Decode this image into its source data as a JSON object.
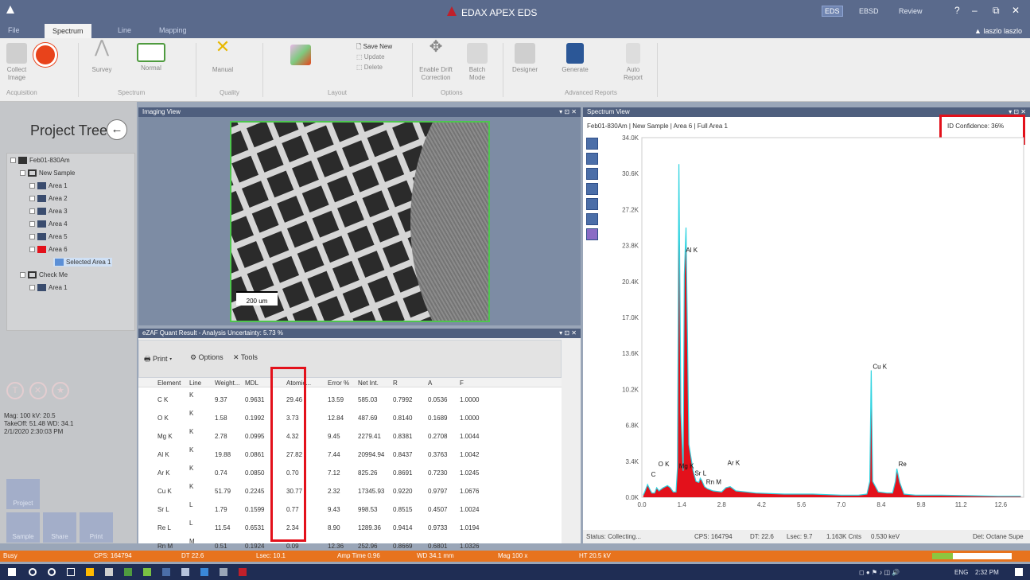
{
  "app": {
    "title": "EDAX APEX EDS",
    "modes": [
      "EDS",
      "EBSD",
      "Review"
    ],
    "active_mode": "EDS",
    "user": "laszlo laszlo"
  },
  "tabs": [
    "File",
    "Spectrum",
    "Line",
    "Mapping"
  ],
  "ribbon": {
    "buttons": [
      {
        "label": "Collect\nImage",
        "name": "collect-image"
      },
      {
        "label": "Survey",
        "name": "survey"
      },
      {
        "label": "Normal",
        "name": "normal"
      },
      {
        "label": "Manual",
        "name": "manual"
      },
      {
        "label": "Save New",
        "name": "save-new"
      },
      {
        "label": "Update",
        "name": "update"
      },
      {
        "label": "Delete",
        "name": "delete"
      },
      {
        "label": "Enable Drift\nCorrection",
        "name": "enable-drift-correction"
      },
      {
        "label": "Batch\nMode",
        "name": "batch-mode"
      },
      {
        "label": "Designer",
        "name": "designer"
      },
      {
        "label": "Generate",
        "name": "generate"
      },
      {
        "label": "Auto\nReport",
        "name": "auto-report"
      }
    ],
    "groups": [
      "Acquisition",
      "Spectrum",
      "Quality",
      "Layout",
      "Options",
      "Advanced Reports"
    ]
  },
  "project": {
    "title": "Project Tree",
    "nodes": [
      "Feb01-830Am",
      "New Sample",
      "Area 1",
      "Area 2",
      "Area 3",
      "Area 4",
      "Area 5",
      "Area 6",
      "Selected Area 1",
      "Check Me",
      "Area 1"
    ],
    "meta": [
      "Mag: 100 kV: 20.5",
      "TakeOff: 51.48 WD: 34.1",
      "2/1/2020 2:30:03 PM"
    ],
    "circles": [
      "T",
      "✕",
      "★"
    ],
    "bottom_buttons": [
      "Project",
      "Sample",
      "Share",
      "Print"
    ]
  },
  "imaging": {
    "title": "Imaging View",
    "scale": "200 um"
  },
  "quant": {
    "title": "eZAF Quant Result - Analysis Uncertainty: 5.73 %",
    "print": "Print",
    "options": "Options",
    "tools": "Tools",
    "headers": [
      "Element",
      "Line",
      "Weight...",
      "MDL",
      "Atomic...",
      "Error %",
      "Net Int.",
      "R",
      "A",
      "F"
    ],
    "rows": [
      [
        "C K",
        "K",
        "9.37",
        "0.9631",
        "29.46",
        "13.59",
        "585.03",
        "0.7992",
        "0.0536",
        "1.0000"
      ],
      [
        "O K",
        "K",
        "1.58",
        "0.1992",
        "3.73",
        "12.84",
        "487.69",
        "0.8140",
        "0.1689",
        "1.0000"
      ],
      [
        "Mg K",
        "K",
        "2.78",
        "0.0995",
        "4.32",
        "9.45",
        "2279.41",
        "0.8381",
        "0.2708",
        "1.0044"
      ],
      [
        "Al K",
        "K",
        "19.88",
        "0.0861",
        "27.82",
        "7.44",
        "20994.94",
        "0.8437",
        "0.3763",
        "1.0042"
      ],
      [
        "Ar K",
        "K",
        "0.74",
        "0.0850",
        "0.70",
        "7.12",
        "825.26",
        "0.8691",
        "0.7230",
        "1.0245"
      ],
      [
        "Cu K",
        "K",
        "51.79",
        "0.2245",
        "30.77",
        "2.32",
        "17345.93",
        "0.9220",
        "0.9797",
        "1.0676"
      ],
      [
        "Sr L",
        "L",
        "1.79",
        "0.1599",
        "0.77",
        "9.43",
        "998.53",
        "0.8515",
        "0.4507",
        "1.0024"
      ],
      [
        "Re L",
        "L",
        "11.54",
        "0.6531",
        "2.34",
        "8.90",
        "1289.36",
        "0.9414",
        "0.9733",
        "1.0194"
      ],
      [
        "Rn M",
        "M",
        "0.51",
        "0.1924",
        "0.09",
        "12.36",
        "252.96",
        "0.8669",
        "0.6801",
        "1.0326"
      ]
    ]
  },
  "spectrum": {
    "title": "Spectrum View",
    "label": "Feb01-830Am | New Sample | Area 6 | Full Area 1",
    "confidence": "ID Confidence: 36%",
    "status": {
      "status": "Status: Collecting...",
      "cps": "CPS: 164794",
      "dt": "DT: 22.6",
      "lsec": "Lsec: 9.7",
      "cnts": "1.163K Cnts",
      "kev": "0.530 keV",
      "det": "Det: Octane Supe"
    }
  },
  "chart_data": {
    "type": "line",
    "ylim": [
      0,
      34
    ],
    "yticks": [
      "0.0K",
      "3.4K",
      "6.8K",
      "10.2K",
      "13.6K",
      "17.0K",
      "20.4K",
      "23.8K",
      "27.2K",
      "30.6K",
      "34.0K"
    ],
    "xticks": [
      "0.0",
      "1.4",
      "2.8",
      "4.2",
      "5.6",
      "7.0",
      "8.4",
      "9.8",
      "11.2",
      "12.6"
    ],
    "xlim": [
      0,
      13.4
    ],
    "series": [
      {
        "x": [
          0.05,
          0.1,
          0.2,
          0.27,
          0.35,
          0.45,
          0.52,
          0.6,
          0.75,
          0.9,
          1.0,
          1.1,
          1.2,
          1.25,
          1.3,
          1.37,
          1.45,
          1.49,
          1.55,
          1.65,
          1.8,
          1.9,
          2.0,
          2.05,
          2.1,
          2.2,
          2.3,
          2.5,
          2.8,
          2.95,
          3.1,
          3.3,
          4.0,
          5.0,
          6.0,
          7.0,
          7.6,
          7.9,
          8.0,
          8.05,
          8.1,
          8.3,
          8.6,
          8.8,
          8.9,
          8.95,
          9.05,
          9.2,
          9.6,
          10.5,
          11.5,
          12.5,
          13.3
        ],
        "y": [
          0.2,
          0.5,
          1.2,
          0.8,
          0.4,
          0.4,
          0.9,
          0.6,
          0.9,
          1.1,
          0.9,
          0.5,
          0.5,
          2.8,
          31.5,
          8.0,
          2.5,
          21.0,
          25.5,
          5.0,
          2.5,
          1.5,
          1.4,
          1.8,
          1.6,
          1.0,
          0.8,
          0.6,
          0.5,
          0.9,
          1.0,
          0.6,
          0.4,
          0.3,
          0.3,
          0.2,
          0.2,
          0.3,
          1.5,
          12.0,
          1.5,
          0.5,
          0.4,
          0.4,
          1.5,
          2.7,
          1.4,
          0.3,
          0.2,
          0.2,
          0.15,
          0.1,
          0.1
        ]
      }
    ],
    "annotations": [
      {
        "text": "Al K",
        "x": 1.49,
        "y": 23.0
      },
      {
        "text": "Cu K",
        "x": 8.05,
        "y": 12.0
      },
      {
        "text": "O K",
        "x": 0.52,
        "y": 2.8
      },
      {
        "text": "C",
        "x": 0.27,
        "y": 1.8
      },
      {
        "text": "Mg K",
        "x": 1.25,
        "y": 2.6
      },
      {
        "text": "Sr L",
        "x": 1.8,
        "y": 1.9
      },
      {
        "text": "Rn M",
        "x": 2.2,
        "y": 1.1
      },
      {
        "text": "Ar K",
        "x": 2.95,
        "y": 2.9
      },
      {
        "text": "Re",
        "x": 8.95,
        "y": 2.8
      }
    ]
  },
  "bottom": {
    "busy": "Busy",
    "cps": "CPS: 164794",
    "dt": "DT 22.6",
    "lsec": "Lsec: 10.1",
    "amp": "Amp Time 0.96",
    "wd": "WD 34.1 mm",
    "mag": "Mag 100 x",
    "ht": "HT 20.5 kV",
    "progress": 0.26
  },
  "tray": {
    "lang": "ENG",
    "time": "2:32 PM"
  }
}
